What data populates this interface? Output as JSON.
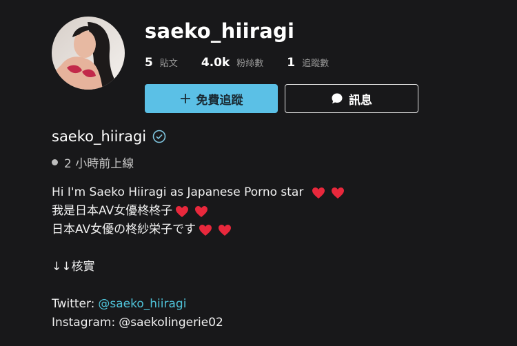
{
  "profile": {
    "username": "saeko_hiiragi",
    "display_name": "saeko_hiiragi",
    "online_status": "2 小時前上線"
  },
  "stats": [
    {
      "value": "5",
      "label": "貼文"
    },
    {
      "value": "4.0k",
      "label": "粉絲數"
    },
    {
      "value": "1",
      "label": "追蹤數"
    }
  ],
  "buttons": {
    "follow_label": "免費追蹤",
    "message_label": "訊息"
  },
  "bio": {
    "line1": "Hi I'm Saeko Hiiragi as Japanese Porno star",
    "line2": "我是日本AV女優柊柊子",
    "line3": "日本AV女優の柊紗栄子です",
    "line4": "↓↓核實",
    "twitter_label": "Twitter:",
    "twitter_handle": "@saeko_hiiragi",
    "instagram_label": "Instagram:",
    "instagram_handle": "@saekolingerie02"
  },
  "colors": {
    "background": "#18181a",
    "follow_button": "#5bc0e6",
    "link": "#4fc3d9",
    "heart": "#e8283c",
    "verified": "#7fc6e0"
  },
  "icons": [
    "plus-icon",
    "chat-bubble-icon",
    "verified-check-icon",
    "heart-icon",
    "online-dot"
  ]
}
